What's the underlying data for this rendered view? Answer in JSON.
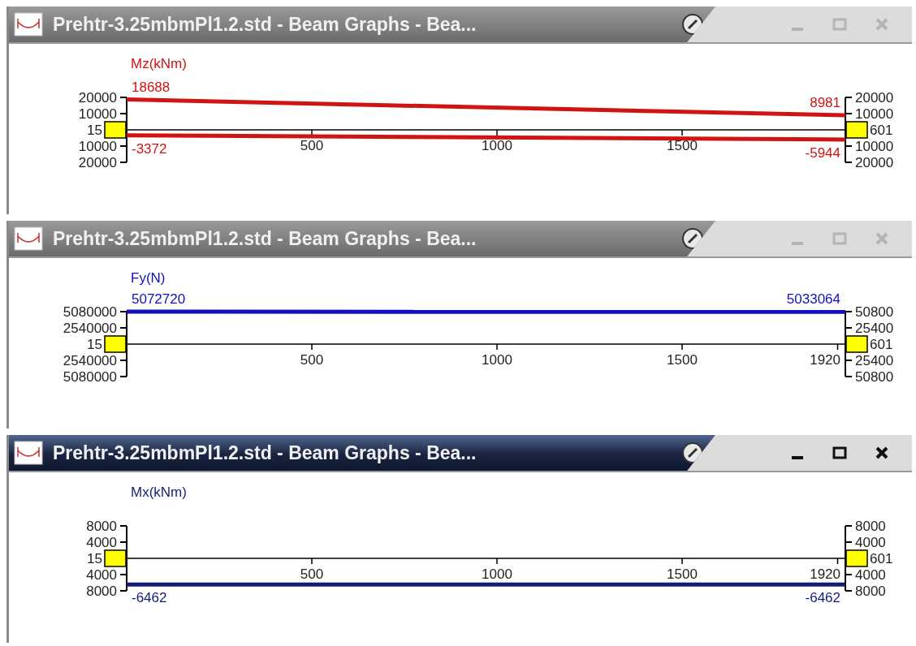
{
  "windows": [
    {
      "title": "Prehtr-3.25mbmPl1.2.std - Beam Graphs - Bea...",
      "active": false,
      "graph": {
        "quantity": "Mz(kNm)",
        "color": "#d01414",
        "left_axis": [
          "20000",
          "10000",
          "10000",
          "20000"
        ],
        "right_axis": [
          "20000",
          "10000",
          "10000",
          "20000"
        ],
        "start_node": "15",
        "end_node": "601",
        "x_ticks": [
          "500",
          "1000",
          "1500"
        ],
        "curves": [
          {
            "start_label": "18688",
            "end_label": "8981"
          },
          {
            "start_label": "-3372",
            "end_label": "-5944"
          }
        ]
      }
    },
    {
      "title": "Prehtr-3.25mbmPl1.2.std - Beam Graphs - Bea...",
      "active": false,
      "graph": {
        "quantity": "Fy(N)",
        "color": "#1010c0",
        "left_axis": [
          "5080000",
          "2540000",
          "2540000",
          "5080000"
        ],
        "right_axis": [
          "50800",
          "25400",
          "25400",
          "50800"
        ],
        "start_node": "15",
        "end_node": "601",
        "x_ticks": [
          "500",
          "1000",
          "1500",
          "1920"
        ],
        "curves": [
          {
            "start_label": "5072720",
            "end_label": "5033064"
          }
        ]
      }
    },
    {
      "title": "Prehtr-3.25mbmPl1.2.std - Beam Graphs - Bea...",
      "active": true,
      "graph": {
        "quantity": "Mx(kNm)",
        "color": "#141c78",
        "left_axis": [
          "8000",
          "4000",
          "4000",
          "8000"
        ],
        "right_axis": [
          "8000",
          "4000",
          "4000",
          "8000"
        ],
        "start_node": "15",
        "end_node": "601",
        "x_ticks": [
          "500",
          "1000",
          "1500",
          "1920"
        ],
        "curves": [
          {
            "start_label": "-6462",
            "end_label": "-6462"
          }
        ]
      }
    }
  ]
}
